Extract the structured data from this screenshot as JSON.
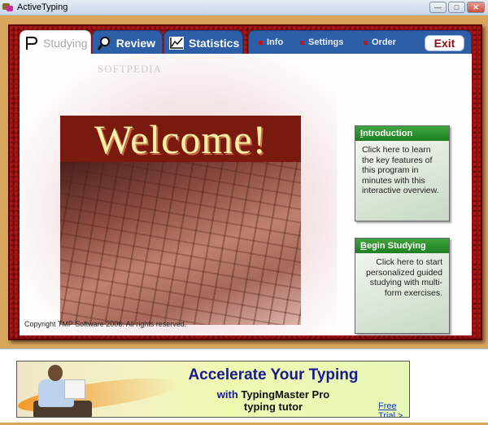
{
  "window": {
    "title": "ActiveTyping",
    "icon": "app-icon",
    "controls": {
      "minimize": "minimize-icon",
      "maximize": "maximize-icon",
      "close": "close-icon"
    }
  },
  "tabs": [
    {
      "label": "Studying",
      "icon": "flag-icon",
      "active": true
    },
    {
      "label": "Review",
      "icon": "magnifier-icon",
      "active": false
    },
    {
      "label": "Statistics",
      "icon": "line-chart-icon",
      "active": false
    }
  ],
  "topnav": {
    "items": [
      {
        "label": "Info"
      },
      {
        "label": "Settings"
      },
      {
        "label": "Order"
      }
    ],
    "exit_label": "Exit"
  },
  "watermark": "SOFTPEDIA",
  "hero": {
    "title": "Welcome!"
  },
  "cards": {
    "introduction": {
      "title": "Introduction",
      "accel": "I",
      "title_rest": "ntroduction",
      "body": "Click here to learn the key features of this program in minutes with this interactive overview."
    },
    "begin_studying": {
      "title": "Begin Studying",
      "accel": "B",
      "title_rest": "egin Studying",
      "body": "Click here to start personalized guided studying with multi-form exercises."
    }
  },
  "copyright": "Copyright TMP Software 2006. All rights reserved.",
  "ad": {
    "headline": "Accelerate Your Typing",
    "sub_with": "with",
    "sub_product": "TypingMaster Pro",
    "sub_line2": "typing tutor",
    "trial_link": "Free Trial >",
    "box_label": "TypingMaster Pro"
  },
  "colors": {
    "tab_blue": "#2d5ea8",
    "frame_red": "#8e1010",
    "card_green": "#2a8f2c",
    "welcome_bg": "#7a1a0e",
    "welcome_text": "#f7f0a6",
    "outer_tan": "#d9a55b",
    "ad_headline": "#1a1a8e"
  }
}
